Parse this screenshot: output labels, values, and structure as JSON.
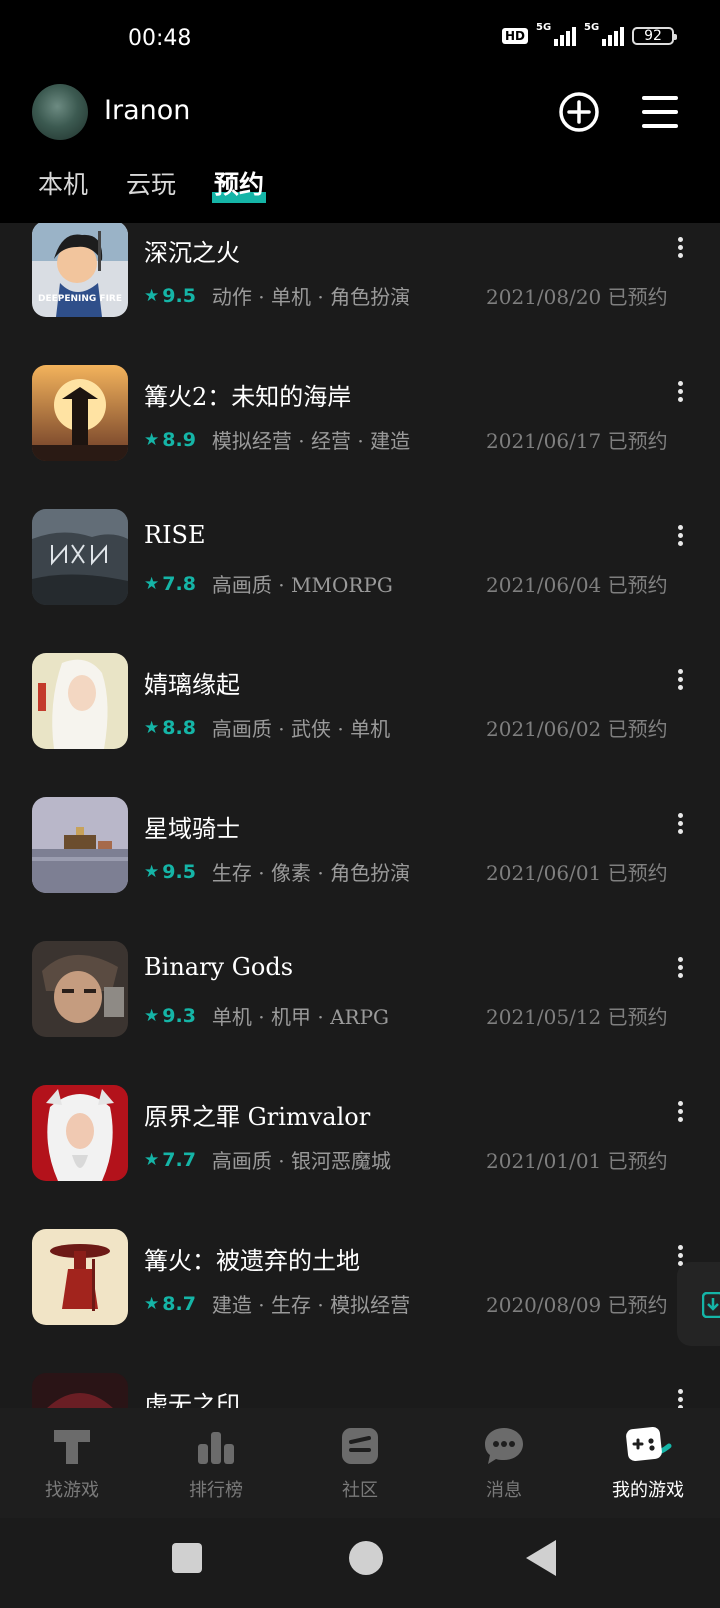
{
  "status": {
    "time": "00:48",
    "hd": "HD",
    "net1": "5G",
    "net2": "5G",
    "battery": "92"
  },
  "header": {
    "username": "Iranon"
  },
  "tabs": [
    {
      "label": "本机"
    },
    {
      "label": "云玩"
    },
    {
      "label": "预约",
      "active": true
    }
  ],
  "games": [
    {
      "title": "深沉之火",
      "score": "9.5",
      "tags": "动作 · 单机 · 角色扮演",
      "date": "2021/08/20 已预约"
    },
    {
      "title": "篝火2：未知的海岸",
      "score": "8.9",
      "tags": "模拟经营 · 经营 · 建造",
      "date": "2021/06/17 已预约"
    },
    {
      "title": "RISE",
      "score": "7.8",
      "tags": "高画质 · MMORPG",
      "date": "2021/06/04 已预约"
    },
    {
      "title": "婧璃缘起",
      "score": "8.8",
      "tags": "高画质 · 武侠 · 单机",
      "date": "2021/06/02 已预约"
    },
    {
      "title": "星域骑士",
      "score": "9.5",
      "tags": "生存 · 像素 · 角色扮演",
      "date": "2021/06/01 已预约"
    },
    {
      "title": "Binary Gods",
      "score": "9.3",
      "tags": "单机 · 机甲 · ARPG",
      "date": "2021/05/12 已预约"
    },
    {
      "title": "原界之罪 Grimvalor",
      "score": "7.7",
      "tags": "高画质 · 银河恶魔城",
      "date": "2021/01/01 已预约"
    },
    {
      "title": "篝火：被遗弃的土地",
      "score": "8.7",
      "tags": "建造 · 生存 · 模拟经营",
      "date": "2020/08/09 已预约"
    },
    {
      "title": "虚无之印",
      "score": "",
      "tags": "",
      "date": ""
    }
  ],
  "thumb_text": {
    "deepening_fire": "DEEPENING FIRE"
  },
  "nav": [
    {
      "label": "找游戏",
      "icon": "find-games-icon"
    },
    {
      "label": "排行榜",
      "icon": "ranking-icon"
    },
    {
      "label": "社区",
      "icon": "community-icon"
    },
    {
      "label": "消息",
      "icon": "message-icon"
    },
    {
      "label": "我的游戏",
      "icon": "my-games-icon",
      "active": true
    }
  ],
  "colors": {
    "accent": "#15b5a7",
    "background": "#1b1b1b",
    "header": "#000000"
  }
}
